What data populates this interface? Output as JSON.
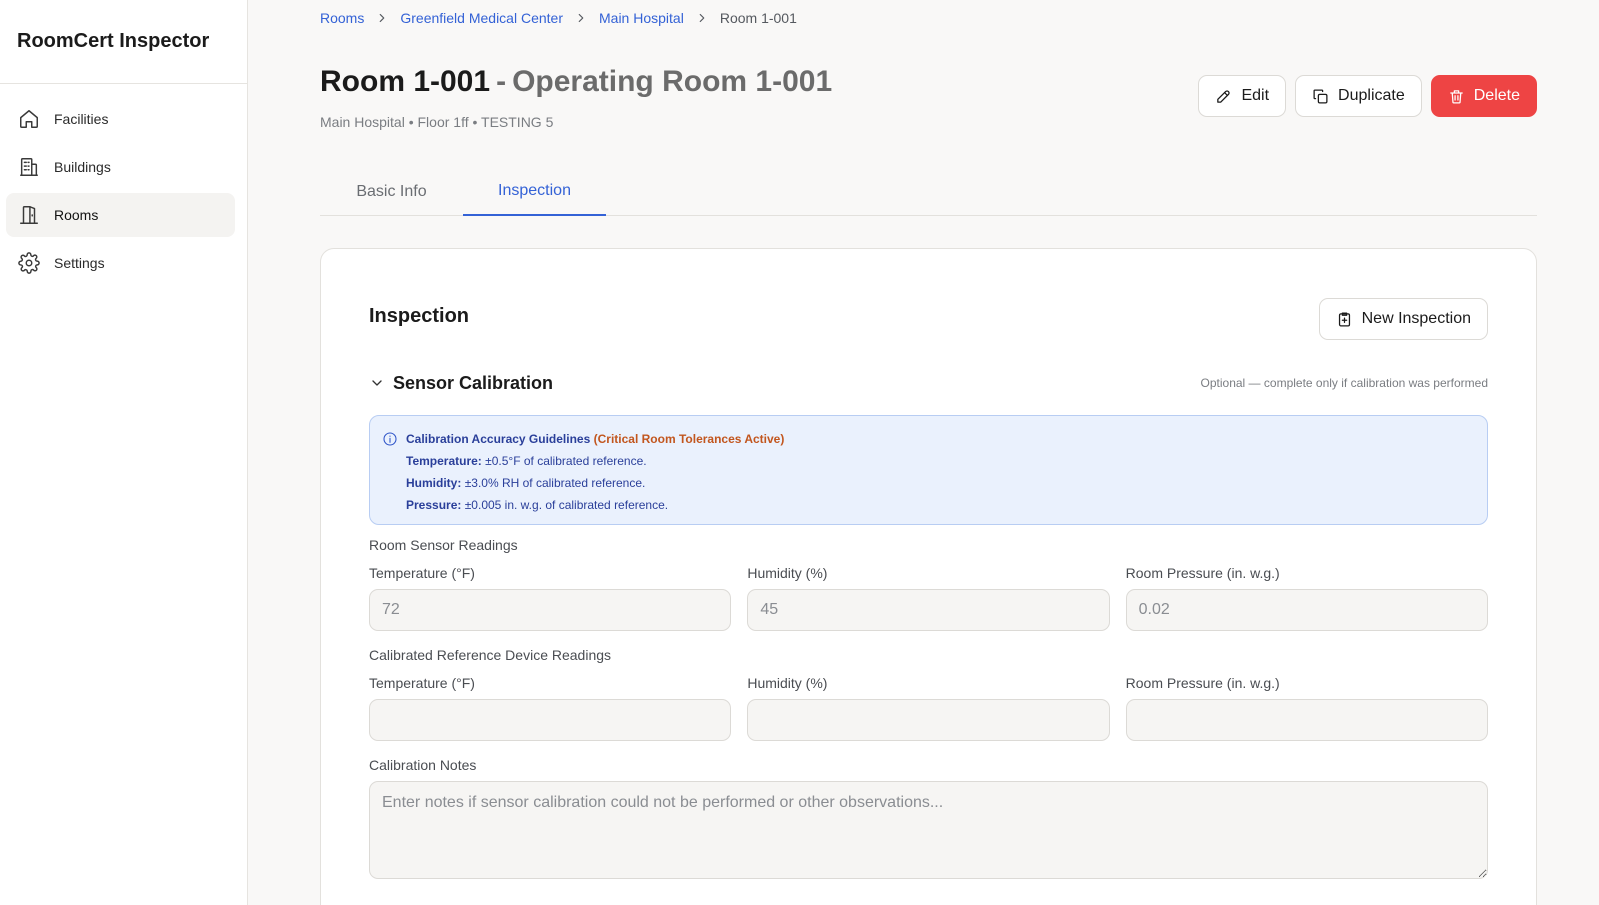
{
  "app": {
    "title": "RoomCert Inspector"
  },
  "sidebar": {
    "items": [
      {
        "label": "Facilities",
        "icon": "home-icon"
      },
      {
        "label": "Buildings",
        "icon": "building-icon"
      },
      {
        "label": "Rooms",
        "icon": "door-icon",
        "active": true
      },
      {
        "label": "Settings",
        "icon": "gear-icon"
      }
    ]
  },
  "breadcrumb": {
    "rooms": "Rooms",
    "facility": "Greenfield Medical Center",
    "building": "Main Hospital",
    "current": "Room 1-001"
  },
  "header": {
    "room_code": "Room 1-001",
    "dash": "-",
    "room_name": "Operating Room 1-001",
    "subtitle": "Main Hospital • Floor 1ff • TESTING 5",
    "edit_label": "Edit",
    "duplicate_label": "Duplicate",
    "delete_label": "Delete"
  },
  "tabs": {
    "basic": "Basic Info",
    "inspection": "Inspection",
    "active": "inspection"
  },
  "inspection": {
    "title": "Inspection",
    "new_label": "New Inspection",
    "section": {
      "title": "Sensor Calibration",
      "hint": "Optional — complete only if calibration was performed"
    },
    "guidelines": {
      "title": "Calibration Accuracy Guidelines",
      "critical": "(Critical Room Tolerances Active)",
      "temp_label": "Temperature:",
      "temp_text": "±0.5°F of calibrated reference.",
      "hum_label": "Humidity:",
      "hum_text": "±3.0% RH of calibrated reference.",
      "pres_label": "Pressure:",
      "pres_text": "±0.005 in. w.g. of calibrated reference."
    },
    "room_readings": {
      "label": "Room Sensor Readings",
      "temp_label": "Temperature (°F)",
      "temp_placeholder": "72",
      "hum_label": "Humidity (%)",
      "hum_placeholder": "45",
      "pres_label": "Room Pressure (in. w.g.)",
      "pres_placeholder": "0.02"
    },
    "ref_readings": {
      "label": "Calibrated Reference Device Readings",
      "temp_label": "Temperature (°F)",
      "hum_label": "Humidity (%)",
      "pres_label": "Room Pressure (in. w.g.)"
    },
    "notes": {
      "label": "Calibration Notes",
      "placeholder": "Enter notes if sensor calibration could not be performed or other observations..."
    }
  },
  "colors": {
    "accent": "#3462d6",
    "danger": "#ee4444",
    "info_bg": "#eaf1fd",
    "critical": "#c2561e"
  }
}
